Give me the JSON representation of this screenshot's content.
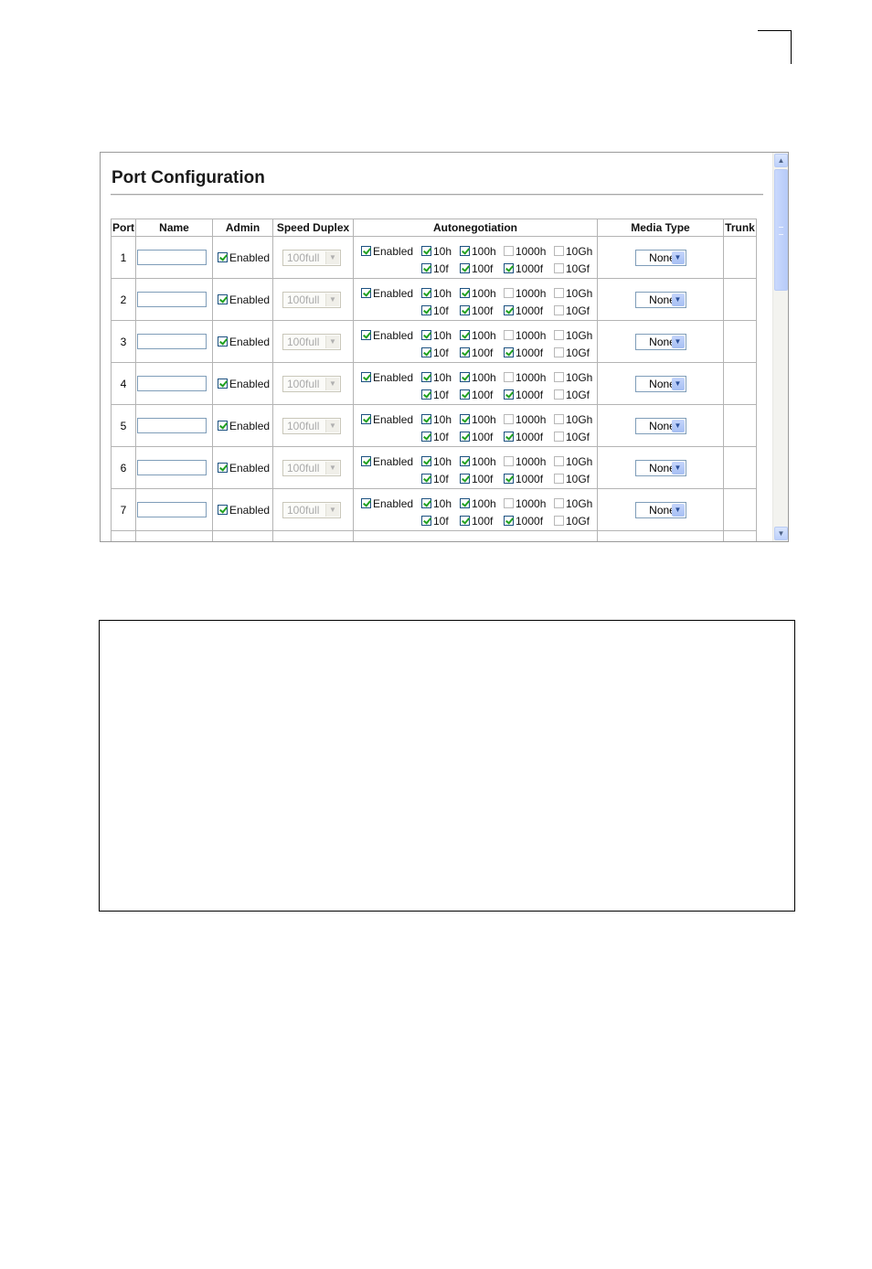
{
  "page": {
    "title": "Port Configuration"
  },
  "table": {
    "headers": {
      "port": "Port",
      "name": "Name",
      "admin": "Admin",
      "speed_duplex": "Speed Duplex",
      "autonegotiation": "Autonegotiation",
      "media_type": "Media Type",
      "trunk": "Trunk"
    },
    "rows": [
      {
        "port": "1",
        "name": "",
        "admin_enabled": true,
        "admin_label": "Enabled",
        "speed_duplex": "100full",
        "auto": {
          "enabled": true,
          "10h": true,
          "100h": true,
          "1000h": false,
          "10Gh": false,
          "10f": true,
          "100f": true,
          "1000f": true,
          "10Gf": false
        },
        "media_type": "None",
        "trunk": ""
      },
      {
        "port": "2",
        "name": "",
        "admin_enabled": true,
        "admin_label": "Enabled",
        "speed_duplex": "100full",
        "auto": {
          "enabled": true,
          "10h": true,
          "100h": true,
          "1000h": false,
          "10Gh": false,
          "10f": true,
          "100f": true,
          "1000f": true,
          "10Gf": false
        },
        "media_type": "None",
        "trunk": ""
      },
      {
        "port": "3",
        "name": "",
        "admin_enabled": true,
        "admin_label": "Enabled",
        "speed_duplex": "100full",
        "auto": {
          "enabled": true,
          "10h": true,
          "100h": true,
          "1000h": false,
          "10Gh": false,
          "10f": true,
          "100f": true,
          "1000f": true,
          "10Gf": false
        },
        "media_type": "None",
        "trunk": ""
      },
      {
        "port": "4",
        "name": "",
        "admin_enabled": true,
        "admin_label": "Enabled",
        "speed_duplex": "100full",
        "auto": {
          "enabled": true,
          "10h": true,
          "100h": true,
          "1000h": false,
          "10Gh": false,
          "10f": true,
          "100f": true,
          "1000f": true,
          "10Gf": false
        },
        "media_type": "None",
        "trunk": ""
      },
      {
        "port": "5",
        "name": "",
        "admin_enabled": true,
        "admin_label": "Enabled",
        "speed_duplex": "100full",
        "auto": {
          "enabled": true,
          "10h": true,
          "100h": true,
          "1000h": false,
          "10Gh": false,
          "10f": true,
          "100f": true,
          "1000f": true,
          "10Gf": false
        },
        "media_type": "None",
        "trunk": ""
      },
      {
        "port": "6",
        "name": "",
        "admin_enabled": true,
        "admin_label": "Enabled",
        "speed_duplex": "100full",
        "auto": {
          "enabled": true,
          "10h": true,
          "100h": true,
          "1000h": false,
          "10Gh": false,
          "10f": true,
          "100f": true,
          "1000f": true,
          "10Gf": false
        },
        "media_type": "None",
        "trunk": ""
      },
      {
        "port": "7",
        "name": "",
        "admin_enabled": true,
        "admin_label": "Enabled",
        "speed_duplex": "100full",
        "auto": {
          "enabled": true,
          "10h": true,
          "100h": true,
          "1000h": false,
          "10Gh": false,
          "10f": true,
          "100f": true,
          "1000f": true,
          "10Gf": false
        },
        "media_type": "None",
        "trunk": ""
      }
    ],
    "auto_labels": {
      "enabled": "Enabled",
      "10h": "10h",
      "100h": "100h",
      "1000h": "1000h",
      "10Gh": "10Gh",
      "10f": "10f",
      "100f": "100f",
      "1000f": "1000f",
      "10Gf": "10Gf"
    }
  },
  "icons": {
    "scroll_up": "arrow-up-icon",
    "scroll_down": "arrow-down-icon",
    "dropdown": "chevron-down-icon"
  },
  "colors": {
    "checkbox_check": "#21a121",
    "input_border": "#7f9db9",
    "scrollbar_accent": "#bcd0fb"
  }
}
